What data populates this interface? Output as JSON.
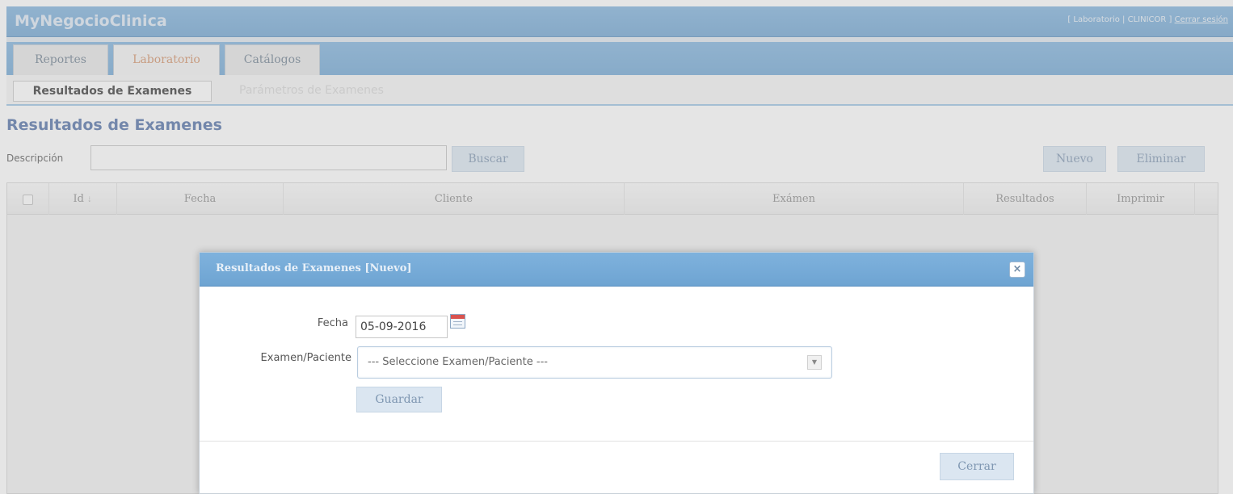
{
  "app": {
    "title": "MyNegocioClinica",
    "context_label": "[ Laboratorio | CLINICOR ]",
    "logout_label": "Cerrar sesión"
  },
  "tabs": [
    {
      "label": "Reportes"
    },
    {
      "label": "Laboratorio",
      "active": true
    },
    {
      "label": "Catálogos"
    }
  ],
  "subnav": {
    "active_label": "Resultados de Examenes",
    "other_label": "Parámetros de Examenes"
  },
  "page": {
    "title": "Resultados de Examenes"
  },
  "search": {
    "label": "Descripción",
    "value": "",
    "button": "Buscar"
  },
  "actions": {
    "new": "Nuevo",
    "delete": "Eliminar"
  },
  "grid": {
    "columns": [
      "Id",
      "Fecha",
      "Cliente",
      "Exámen",
      "Resultados",
      "Imprimir"
    ]
  },
  "modal": {
    "title": "Resultados de Examenes [Nuevo]",
    "close_icon": "×",
    "fecha_label": "Fecha",
    "fecha_value": "05-09-2016",
    "examen_label": "Examen/Paciente",
    "examen_placeholder": "--- Seleccione Examen/Paciente ---",
    "save_button": "Guardar",
    "close_button": "Cerrar"
  },
  "colors": {
    "header_blue": "#7fb2dd",
    "active_tab_text": "#d39066",
    "title_blue": "#506fa6"
  }
}
